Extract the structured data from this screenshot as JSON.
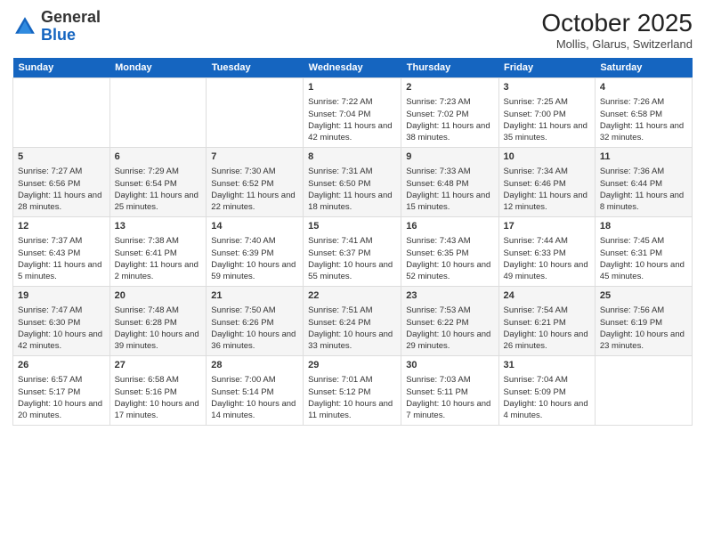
{
  "logo": {
    "line1": "General",
    "line2": "Blue"
  },
  "header": {
    "title": "October 2025",
    "location": "Mollis, Glarus, Switzerland"
  },
  "days": [
    "Sunday",
    "Monday",
    "Tuesday",
    "Wednesday",
    "Thursday",
    "Friday",
    "Saturday"
  ],
  "weeks": [
    [
      {
        "num": "",
        "text": ""
      },
      {
        "num": "",
        "text": ""
      },
      {
        "num": "",
        "text": ""
      },
      {
        "num": "1",
        "text": "Sunrise: 7:22 AM\nSunset: 7:04 PM\nDaylight: 11 hours and 42 minutes."
      },
      {
        "num": "2",
        "text": "Sunrise: 7:23 AM\nSunset: 7:02 PM\nDaylight: 11 hours and 38 minutes."
      },
      {
        "num": "3",
        "text": "Sunrise: 7:25 AM\nSunset: 7:00 PM\nDaylight: 11 hours and 35 minutes."
      },
      {
        "num": "4",
        "text": "Sunrise: 7:26 AM\nSunset: 6:58 PM\nDaylight: 11 hours and 32 minutes."
      }
    ],
    [
      {
        "num": "5",
        "text": "Sunrise: 7:27 AM\nSunset: 6:56 PM\nDaylight: 11 hours and 28 minutes."
      },
      {
        "num": "6",
        "text": "Sunrise: 7:29 AM\nSunset: 6:54 PM\nDaylight: 11 hours and 25 minutes."
      },
      {
        "num": "7",
        "text": "Sunrise: 7:30 AM\nSunset: 6:52 PM\nDaylight: 11 hours and 22 minutes."
      },
      {
        "num": "8",
        "text": "Sunrise: 7:31 AM\nSunset: 6:50 PM\nDaylight: 11 hours and 18 minutes."
      },
      {
        "num": "9",
        "text": "Sunrise: 7:33 AM\nSunset: 6:48 PM\nDaylight: 11 hours and 15 minutes."
      },
      {
        "num": "10",
        "text": "Sunrise: 7:34 AM\nSunset: 6:46 PM\nDaylight: 11 hours and 12 minutes."
      },
      {
        "num": "11",
        "text": "Sunrise: 7:36 AM\nSunset: 6:44 PM\nDaylight: 11 hours and 8 minutes."
      }
    ],
    [
      {
        "num": "12",
        "text": "Sunrise: 7:37 AM\nSunset: 6:43 PM\nDaylight: 11 hours and 5 minutes."
      },
      {
        "num": "13",
        "text": "Sunrise: 7:38 AM\nSunset: 6:41 PM\nDaylight: 11 hours and 2 minutes."
      },
      {
        "num": "14",
        "text": "Sunrise: 7:40 AM\nSunset: 6:39 PM\nDaylight: 10 hours and 59 minutes."
      },
      {
        "num": "15",
        "text": "Sunrise: 7:41 AM\nSunset: 6:37 PM\nDaylight: 10 hours and 55 minutes."
      },
      {
        "num": "16",
        "text": "Sunrise: 7:43 AM\nSunset: 6:35 PM\nDaylight: 10 hours and 52 minutes."
      },
      {
        "num": "17",
        "text": "Sunrise: 7:44 AM\nSunset: 6:33 PM\nDaylight: 10 hours and 49 minutes."
      },
      {
        "num": "18",
        "text": "Sunrise: 7:45 AM\nSunset: 6:31 PM\nDaylight: 10 hours and 45 minutes."
      }
    ],
    [
      {
        "num": "19",
        "text": "Sunrise: 7:47 AM\nSunset: 6:30 PM\nDaylight: 10 hours and 42 minutes."
      },
      {
        "num": "20",
        "text": "Sunrise: 7:48 AM\nSunset: 6:28 PM\nDaylight: 10 hours and 39 minutes."
      },
      {
        "num": "21",
        "text": "Sunrise: 7:50 AM\nSunset: 6:26 PM\nDaylight: 10 hours and 36 minutes."
      },
      {
        "num": "22",
        "text": "Sunrise: 7:51 AM\nSunset: 6:24 PM\nDaylight: 10 hours and 33 minutes."
      },
      {
        "num": "23",
        "text": "Sunrise: 7:53 AM\nSunset: 6:22 PM\nDaylight: 10 hours and 29 minutes."
      },
      {
        "num": "24",
        "text": "Sunrise: 7:54 AM\nSunset: 6:21 PM\nDaylight: 10 hours and 26 minutes."
      },
      {
        "num": "25",
        "text": "Sunrise: 7:56 AM\nSunset: 6:19 PM\nDaylight: 10 hours and 23 minutes."
      }
    ],
    [
      {
        "num": "26",
        "text": "Sunrise: 6:57 AM\nSunset: 5:17 PM\nDaylight: 10 hours and 20 minutes."
      },
      {
        "num": "27",
        "text": "Sunrise: 6:58 AM\nSunset: 5:16 PM\nDaylight: 10 hours and 17 minutes."
      },
      {
        "num": "28",
        "text": "Sunrise: 7:00 AM\nSunset: 5:14 PM\nDaylight: 10 hours and 14 minutes."
      },
      {
        "num": "29",
        "text": "Sunrise: 7:01 AM\nSunset: 5:12 PM\nDaylight: 10 hours and 11 minutes."
      },
      {
        "num": "30",
        "text": "Sunrise: 7:03 AM\nSunset: 5:11 PM\nDaylight: 10 hours and 7 minutes."
      },
      {
        "num": "31",
        "text": "Sunrise: 7:04 AM\nSunset: 5:09 PM\nDaylight: 10 hours and 4 minutes."
      },
      {
        "num": "",
        "text": ""
      }
    ]
  ]
}
